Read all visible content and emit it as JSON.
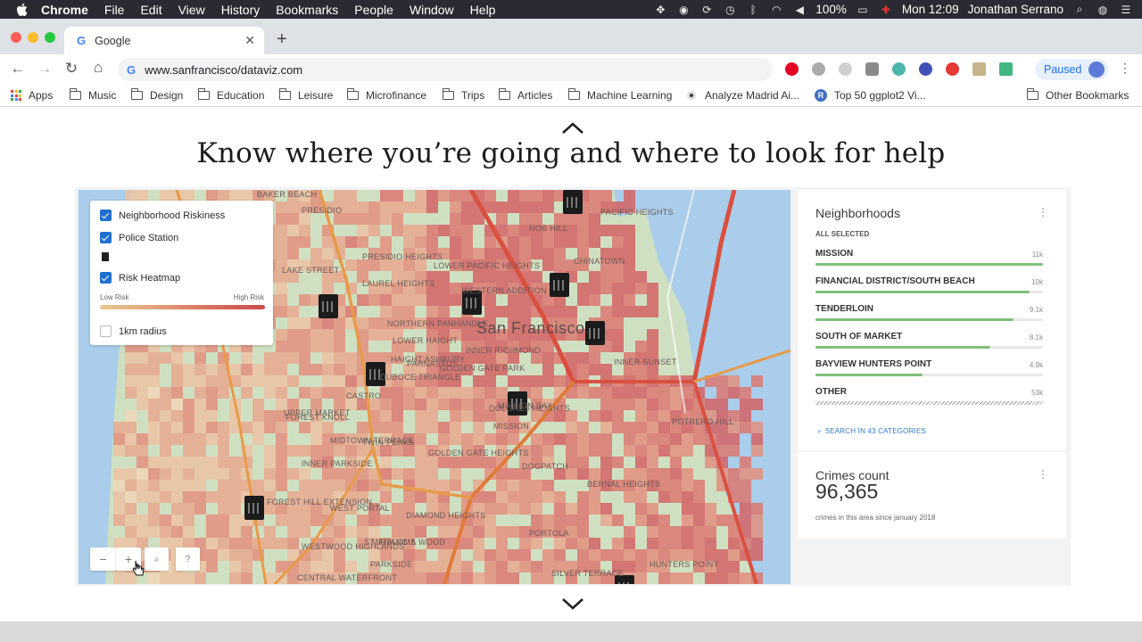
{
  "menubar": {
    "app_name": "Chrome",
    "menus": [
      "File",
      "Edit",
      "View",
      "History",
      "Bookmarks",
      "People",
      "Window",
      "Help"
    ],
    "battery": "100%",
    "clock": "Mon 12:09",
    "user": "Jonathan Serrano"
  },
  "tab": {
    "title": "Google",
    "favicon": "G"
  },
  "omnibox": {
    "url": "www.sanfrancisco/dataviz.com"
  },
  "profile": {
    "label": "Paused"
  },
  "bookmarks": {
    "items": [
      "Apps",
      "Music",
      "Design",
      "Education",
      "Leisure",
      "Microfinance",
      "Trips",
      "Articles",
      "Machine Learning",
      "Analyze Madrid Ai...",
      "Top 50 ggplot2 Vi...",
      "Other Bookmarks"
    ]
  },
  "page": {
    "headline": "Know where you’re going and where to look for help"
  },
  "legend": {
    "items": [
      "Neighborhood Riskiness",
      "Police Station",
      "Risk Heatmap"
    ],
    "low_risk": "Low Risk",
    "high_risk": "High Risk",
    "radius": "1km radius"
  },
  "map": {
    "city": "San Francisco",
    "labels": [
      "BAKER BEACH",
      "PRESIDIO",
      "LAKE STREET",
      "PRESIDIO HEIGHTS",
      "LAUREL HEIGHTS",
      "LOWER PACIFIC HEIGHTS",
      "WESTERN ADDITION",
      "NOB HILL",
      "PACIFIC HEIGHTS",
      "CHINATOWN",
      "NORTHERN PANHANDLE",
      "LOWER HAIGHT",
      "HAIGHT ASHBURY",
      "DUBOCE TRIANGLE",
      "INNER RICHMOND",
      "GOLDEN GATE PARK",
      "PARNASSUS",
      "UPPER MARKET",
      "CASTRO",
      "DOLORES HEIGHTS",
      "MISSION",
      "MISSION BAY",
      "INNER SUNSET",
      "FOREST KNOLL",
      "MIDTOWN TERRACE",
      "TWIN PEAKS",
      "GOLDEN GATE HEIGHTS",
      "INNER PARKSIDE",
      "FOREST HILL EXTENSION",
      "WEST PORTAL",
      "DIAMOND HEIGHTS",
      "MIRALOMA",
      "ST. FRANCIS WOOD",
      "WESTWOOD HIGHLANDS",
      "PARKSIDE",
      "CENTRAL WATERFRONT",
      "POTRERO HILL",
      "DOGPATCH",
      "BERNAL HEIGHTS",
      "PORTOLA",
      "SILVER TERRACE",
      "HUNTERS POINT"
    ]
  },
  "neighborhoods": {
    "title": "Neighborhoods",
    "subtitle": "ALL SELECTED",
    "categories": [
      {
        "name": "MISSION",
        "value": "11k",
        "fraction": 1.0
      },
      {
        "name": "FINANCIAL DISTRICT/SOUTH BEACH",
        "value": "10k",
        "fraction": 0.94
      },
      {
        "name": "TENDERLOIN",
        "value": "9.1k",
        "fraction": 0.87
      },
      {
        "name": "SOUTH OF MARKET",
        "value": "8.1k",
        "fraction": 0.77
      },
      {
        "name": "BAYVIEW HUNTERS POINT",
        "value": "4.9k",
        "fraction": 0.47
      },
      {
        "name": "OTHER",
        "value": "53k",
        "fraction": 1.0
      }
    ],
    "search_link": "SEARCH IN 43 CATEGORIES"
  },
  "crimes": {
    "title": "Crimes count",
    "count": "96,365",
    "subtitle": "crimes in this area since january 2018"
  },
  "colors": {
    "accent": "#1f6fd1",
    "bar": "#80c07a",
    "road": "#d9503f",
    "heat_high": "#c94b4b",
    "heat_low": "#e8c991"
  }
}
